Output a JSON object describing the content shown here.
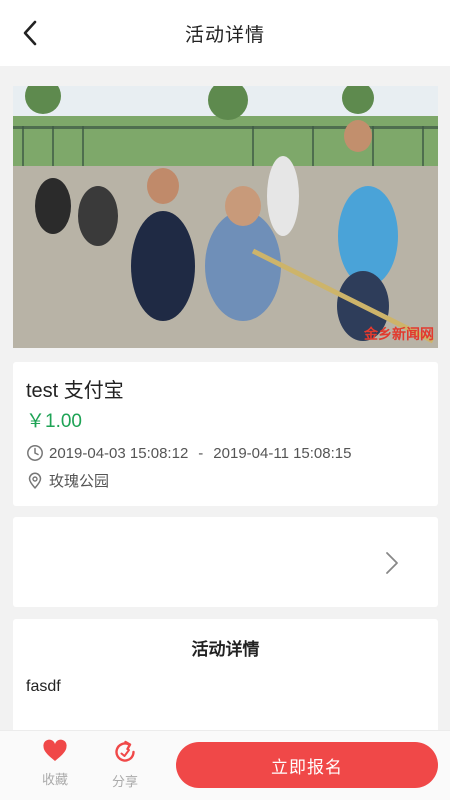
{
  "navbar": {
    "title": "活动详情",
    "back_icon": "chevron-left-icon"
  },
  "banner": {
    "watermark": "金乡新闻网"
  },
  "event": {
    "name": "test 支付宝",
    "price": "￥1.00",
    "start_time": "2019-04-03 15:08:12",
    "separator": "-",
    "end_time": "2019-04-11 15:08:15",
    "location": "玫瑰公园",
    "price_color": "#1ea355"
  },
  "details": {
    "heading": "活动详情",
    "body": "fasdf"
  },
  "bottom_bar": {
    "favorite_label": "收藏",
    "share_label": "分享",
    "signup_label": "立即报名",
    "accent_color": "#f04848"
  }
}
